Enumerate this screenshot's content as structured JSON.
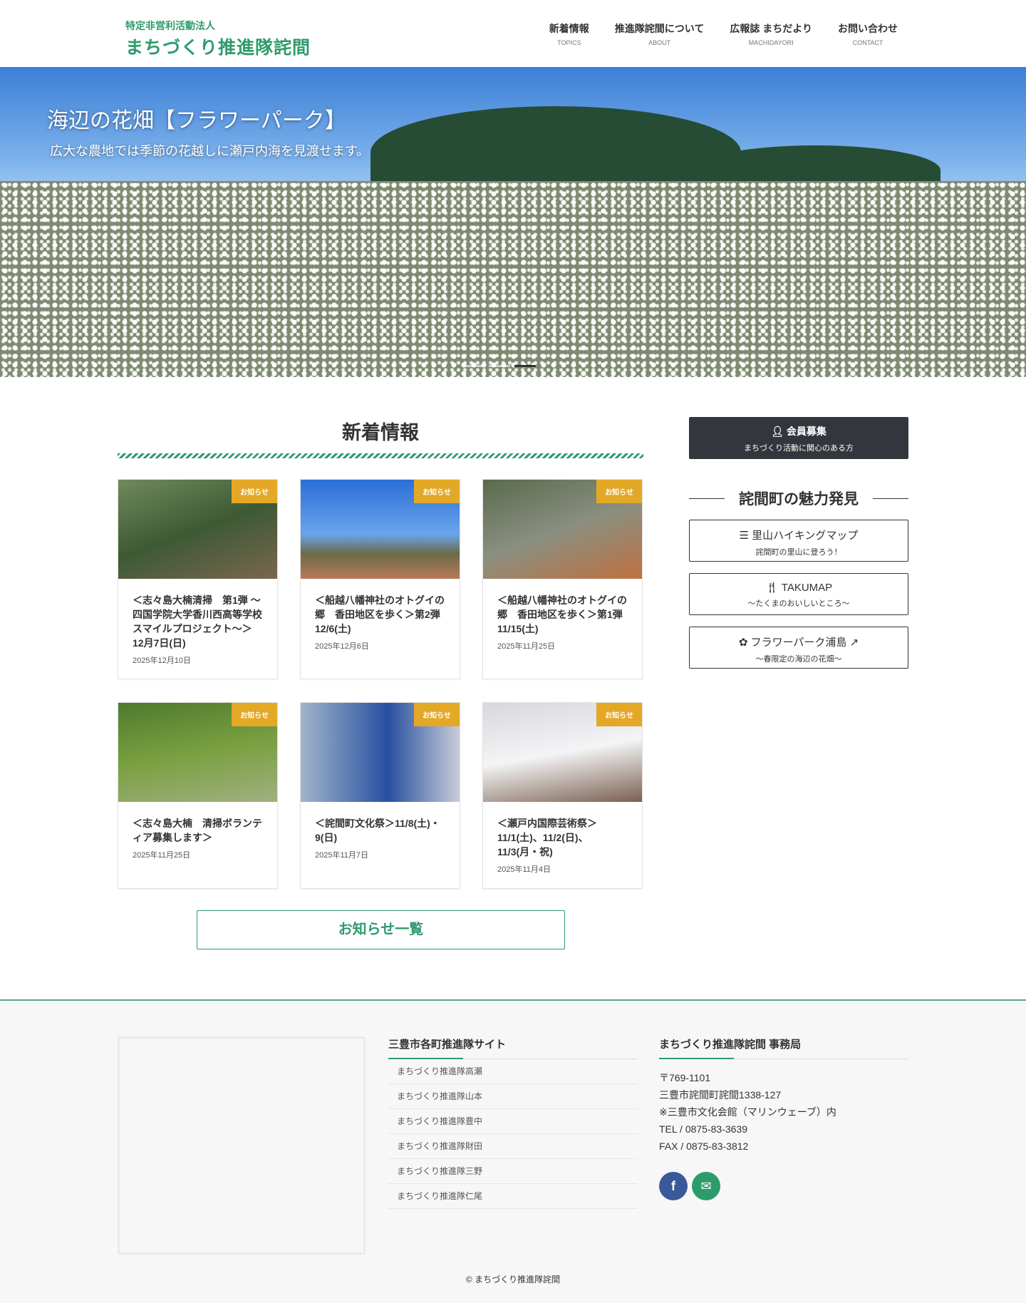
{
  "header": {
    "org_type": "特定非営利活動法人",
    "org_name": "まちづくり推進隊詫間",
    "nav": [
      {
        "ja": "新着情報",
        "en": "TOPICS"
      },
      {
        "ja": "推進隊詫間について",
        "en": "ABOUT"
      },
      {
        "ja": "広報誌 まちだより",
        "en": "MACHIDAYORI"
      },
      {
        "ja": "お問い合わせ",
        "en": "CONTACT"
      }
    ]
  },
  "hero": {
    "title": "海辺の花畑【フラワーパーク】",
    "subtitle": "広大な農地では季節の花越しに瀬戸内海を見渡せます。",
    "slide_count": 3,
    "active_slide": 3
  },
  "news": {
    "title": "新着情報",
    "badge": "お知らせ",
    "items": [
      {
        "title": "＜志々島大楠清掃　第1弾 〜四国学院大学香川西高等学校　スマイルプロジェクト〜＞12月7日(日)",
        "date": "2025年12月10日"
      },
      {
        "title": "＜船越八幡神社のオトグイの郷　香田地区を歩く＞第2弾12/6(土)",
        "date": "2025年12月6日"
      },
      {
        "title": "＜船越八幡神社のオトグイの郷　香田地区を歩く＞第1弾11/15(土)",
        "date": "2025年11月25日"
      },
      {
        "title": "＜志々島大楠　清掃ボランティア募集します＞",
        "date": "2025年11月25日"
      },
      {
        "title": "＜詫間町文化祭＞11/8(土)・9(日)",
        "date": "2025年11月7日"
      },
      {
        "title": "＜瀬戸内国際芸術祭＞11/1(土)、11/2(日)、11/3(月・祝)",
        "date": "2025年11月4日"
      }
    ],
    "more_label": "お知らせ一覧"
  },
  "sidebar": {
    "member": {
      "title": "会員募集",
      "sub": "まちづくり活動に関心のある方"
    },
    "heading": "詫間町の魅力発見",
    "links": [
      {
        "title": "里山ハイキングマップ",
        "sub": "詫間町の里山に登ろう！",
        "icon": "signpost-icon"
      },
      {
        "title": "TAKUMAP",
        "sub": "〜たくまのおいしいところ〜",
        "icon": "utensils-icon"
      },
      {
        "title": "フラワーパーク浦島",
        "sub": "〜春限定の海辺の花畑〜",
        "icon": "leaf-icon"
      }
    ]
  },
  "footer": {
    "sites_title": "三豊市各町推進隊サイト",
    "sites": [
      "まちづくり推進隊高瀬",
      "まちづくり推進隊山本",
      "まちづくり推進隊豊中",
      "まちづくり推進隊財田",
      "まちづくり推進隊三野",
      "まちづくり推進隊仁尾"
    ],
    "office_title": "まちづくり推進隊詫間 事務局",
    "address": [
      "〒769-1101",
      "三豊市詫間町詫間1338-127",
      "※三豊市文化会館（マリンウェーブ）内",
      "TEL / 0875-83-3639",
      "FAX / 0875-83-3812"
    ],
    "copyright": "© まちづくり推進隊詫間"
  },
  "colors": {
    "brand": "#2e9b6c",
    "badge": "#e4a827",
    "dark": "#33363c",
    "facebook": "#3b5998",
    "mail": "#2e9b6c"
  }
}
